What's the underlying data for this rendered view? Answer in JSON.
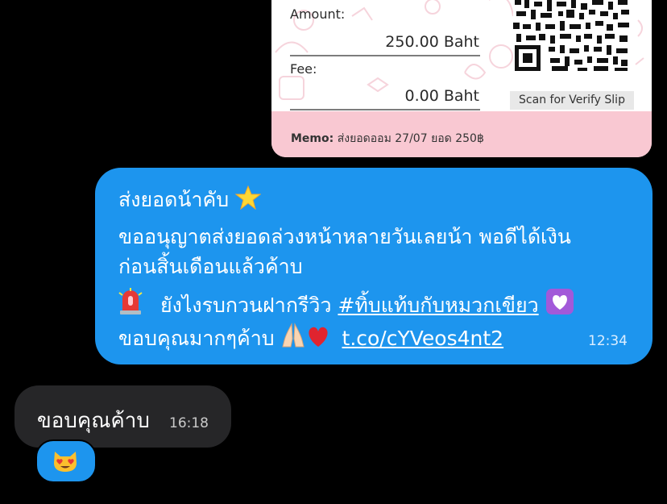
{
  "slip": {
    "amount_label": "Amount:",
    "amount_value": "250.00 Baht",
    "fee_label": "Fee:",
    "fee_value": "0.00 Baht",
    "qr_caption": "Scan for Verify Slip",
    "memo_prefix": "Memo:",
    "memo_text": "ส่งยอดออม 27/07 ยอด 250฿"
  },
  "outgoing": {
    "line1": "ส่งยอดน้าคับ",
    "line2": "ขออนุญาตส่งยอดล่วงหน้าหลายวันเลยน้า พอดีได้เงิน",
    "line3": "ก่อนสิ้นเดือนแล้วค้าบ",
    "line4_text": "ยังไงรบกวนฝากรีวิว",
    "line4_hashtag": "#ทิ้บแท้บกับหมวกเขียว",
    "line5_text": "ขอบคุณมากๆค้าบ",
    "line5_link": "t.co/cYVeos4nt2",
    "time": "12:34",
    "color": "#1d95ee"
  },
  "incoming": {
    "text": "ขอบคุณค้าบ",
    "time": "16:18",
    "color": "#262628"
  },
  "icons": {
    "star": "star-icon",
    "siren": "siren-icon",
    "heart": "purple-heart-icon",
    "pray": "folded-hands-icon",
    "red_heart": "red-heart-icon",
    "reaction": "heart-eyes-cat-icon"
  }
}
